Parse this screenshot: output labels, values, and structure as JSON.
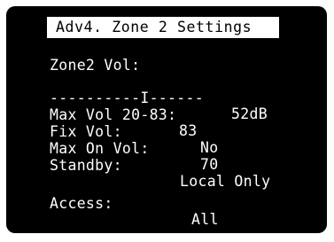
{
  "title": "Adv4. Zone 2 Settings",
  "zone2_vol": {
    "label": "Zone2 Vol:",
    "bar": "----------I------",
    "value": "52dB",
    "level_fraction": 0.61
  },
  "rows": [
    {
      "label": "Max Vol 20-83:",
      "value": "83"
    },
    {
      "label": "Fix Vol:",
      "value": "No"
    },
    {
      "label": "Max On Vol:",
      "value": "70"
    },
    {
      "label": "Standby:",
      "value": "Local Only"
    }
  ],
  "access": {
    "label": "Access:",
    "value": "All"
  },
  "colors": {
    "screen_bg": "#000000",
    "text": "#ffffff",
    "title_bg": "#ffffff",
    "title_text": "#000000"
  }
}
